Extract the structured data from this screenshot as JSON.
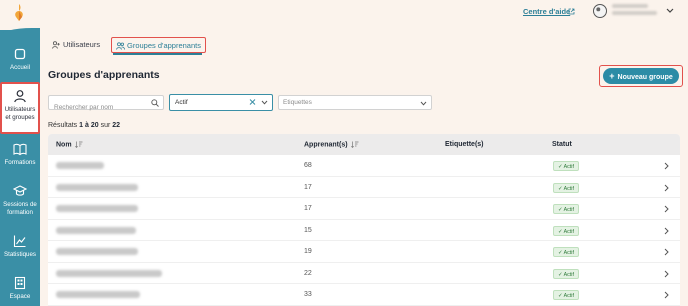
{
  "sidebar": {
    "items": [
      {
        "label": "Accueil",
        "icon": "home-icon"
      },
      {
        "label": "Utilisateurs et groupes",
        "icon": "user-icon"
      },
      {
        "label": "Formations",
        "icon": "book-icon"
      },
      {
        "label": "Sessions de formation",
        "icon": "graduation-cap-icon"
      },
      {
        "label": "Statistiques",
        "icon": "chart-line-icon"
      },
      {
        "label": "Espace",
        "icon": "building-icon"
      }
    ],
    "active_index": 1,
    "color": "#3a8fa6"
  },
  "topbar": {
    "help_label": "Centre d'aide"
  },
  "tabs": [
    {
      "label": "Utilisateurs",
      "active": false
    },
    {
      "label": "Groupes d'apprenants",
      "active": true
    }
  ],
  "page": {
    "title": "Groupes d'apprenants",
    "new_button_label": "Nouveau groupe"
  },
  "filters": {
    "search_placeholder": "Rechercher par nom",
    "status_value": "Actif",
    "labels_placeholder": "Etiquettes"
  },
  "results": {
    "prefix": "Résultats",
    "range": "1 à 20",
    "mid": "sur",
    "total": "22"
  },
  "table": {
    "columns": [
      "Nom",
      "Apprenant(s)",
      "Etiquette(s)",
      "Statut"
    ],
    "rows": [
      {
        "count": "68",
        "status": "Actif"
      },
      {
        "count": "17",
        "status": "Actif"
      },
      {
        "count": "17",
        "status": "Actif"
      },
      {
        "count": "15",
        "status": "Actif"
      },
      {
        "count": "19",
        "status": "Actif"
      },
      {
        "count": "22",
        "status": "Actif"
      },
      {
        "count": "33",
        "status": "Actif"
      }
    ]
  },
  "colors": {
    "accent": "#2c8ca6",
    "highlight_border": "#e2514c",
    "status_green": "#2f7a3a"
  }
}
